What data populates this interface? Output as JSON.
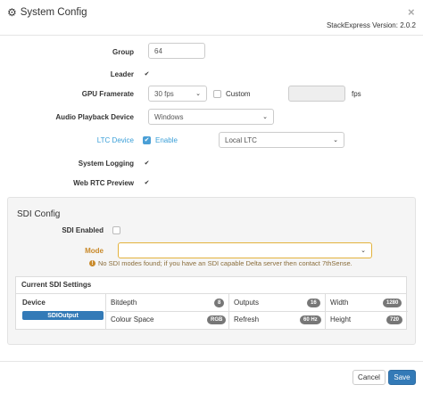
{
  "header": {
    "title": "System Config",
    "version": "StackExpress Version: 2.0.2"
  },
  "form": {
    "group": {
      "label": "Group",
      "value": "64"
    },
    "leader": {
      "label": "Leader",
      "checked": true
    },
    "gpu_framerate": {
      "label": "GPU Framerate",
      "selected": "30 fps",
      "custom_label": "Custom",
      "custom_checked": false,
      "unit": "fps"
    },
    "audio_playback": {
      "label": "Audio Playback Device",
      "selected": "Windows"
    },
    "ltc_device": {
      "label": "LTC Device",
      "enable_label": "Enable",
      "enabled": true,
      "selected": "Local LTC"
    },
    "system_logging": {
      "label": "System Logging",
      "checked": true
    },
    "web_rtc_preview": {
      "label": "Web RTC Preview",
      "checked": true
    }
  },
  "sdi": {
    "title": "SDI Config",
    "enabled_label": "SDI Enabled",
    "enabled": false,
    "mode_label": "Mode",
    "mode_selected": "",
    "warning": "No SDI modes found; if you have an SDI capable Delta server then contact 7thSense.",
    "settings": {
      "title": "Current SDI Settings",
      "device_header": "Device",
      "device_name": "SDIOutput",
      "bitdepth_label": "Bitdepth",
      "bitdepth": "8",
      "outputs_label": "Outputs",
      "outputs": "16",
      "width_label": "Width",
      "width": "1280",
      "colour_space_label": "Colour Space",
      "colour_space": "RGB",
      "refresh_label": "Refresh",
      "refresh": "60 Hz",
      "height_label": "Height",
      "height": "720"
    }
  },
  "footer": {
    "cancel_label": "Cancel",
    "save_label": "Save"
  },
  "colors": {
    "primary": "#337ab7",
    "link_blue": "#3a9fd8",
    "warning": "#c98a2b"
  }
}
